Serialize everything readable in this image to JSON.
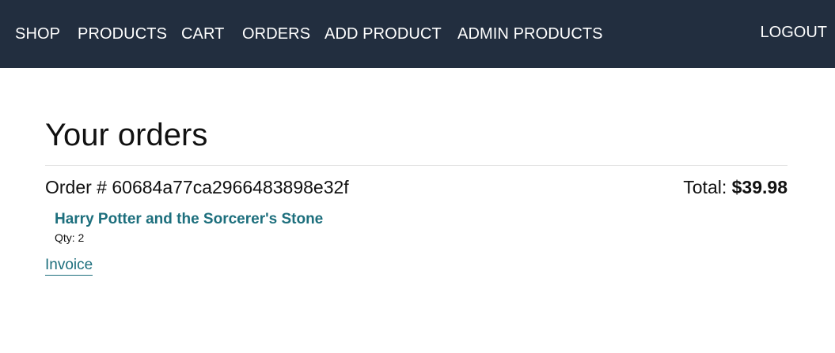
{
  "nav": {
    "items": [
      {
        "id": "shop",
        "label": "SHOP"
      },
      {
        "id": "products",
        "label": "PRODUCTS"
      },
      {
        "id": "cart",
        "label": "CART"
      },
      {
        "id": "orders",
        "label": "ORDERS"
      },
      {
        "id": "add-product",
        "label": "ADD PRODUCT"
      },
      {
        "id": "admin-products",
        "label": "ADMIN PRODUCTS"
      }
    ],
    "logout_label": "LOGOUT"
  },
  "page": {
    "title": "Your orders"
  },
  "orders": [
    {
      "order_label": "Order # 60684a77ca2966483898e32f",
      "total_prefix": "Total: ",
      "total_amount": "$39.98",
      "items": [
        {
          "title": "Harry Potter and the Sorcerer's Stone",
          "qty_label": "Qty: 2"
        }
      ],
      "invoice_label": "Invoice"
    }
  ],
  "colors": {
    "topbar": "#222e3f",
    "link": "#1d6f7d"
  }
}
